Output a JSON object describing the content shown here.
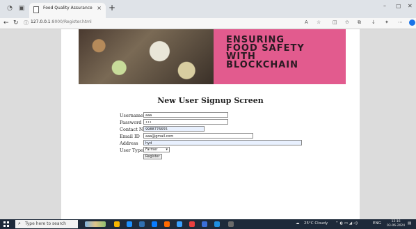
{
  "browser": {
    "tab_title": "Food Quality Assurance",
    "tab_close": "×",
    "new_tab": "+",
    "url_host": "127.0.0.1",
    "url_rest": ":8000/Register.html",
    "window_controls": [
      "–",
      "▢",
      "✕"
    ],
    "icons": [
      "profile-icon",
      "tab-actions-icon",
      "page-icon",
      "close-icon",
      "back-icon",
      "refresh-icon",
      "info-icon",
      "read-aloud-icon",
      "favorite-icon",
      "split-screen-icon",
      "favorites-icon",
      "collections-icon",
      "downloads-icon",
      "extensions-icon",
      "more-icon",
      "copilot-icon"
    ]
  },
  "banner": {
    "text": "ENSURING\nFOOD SAFETY\nWITH\nBLOCKCHAIN"
  },
  "page": {
    "heading": "New User Signup Screen"
  },
  "form": {
    "username_label": "Username",
    "username_value": "aaa",
    "password_label": "Password",
    "password_value": "•••",
    "contact_label": "Contact No",
    "contact_value": "9988776655",
    "email_label": "Email ID",
    "email_value": "aaa@gmail.com",
    "address_label": "Address",
    "address_value": "hyd",
    "usertype_label": "User Type",
    "usertype_value": "Farmer",
    "register_label": "Register"
  },
  "taskbar": {
    "search_placeholder": "Type here to search",
    "weather": "25°C  Cloudy",
    "language": "ENG",
    "time": "12:16",
    "date": "03-06-2024",
    "app_colors": [
      "#f7b500",
      "#1e90ff",
      "#2f6fb2",
      "#0a7cff",
      "#ff6a00",
      "#3aa0ff",
      "#e94040",
      "#3b6fd8",
      "#1f8fe0",
      "#6a6a6a"
    ]
  }
}
